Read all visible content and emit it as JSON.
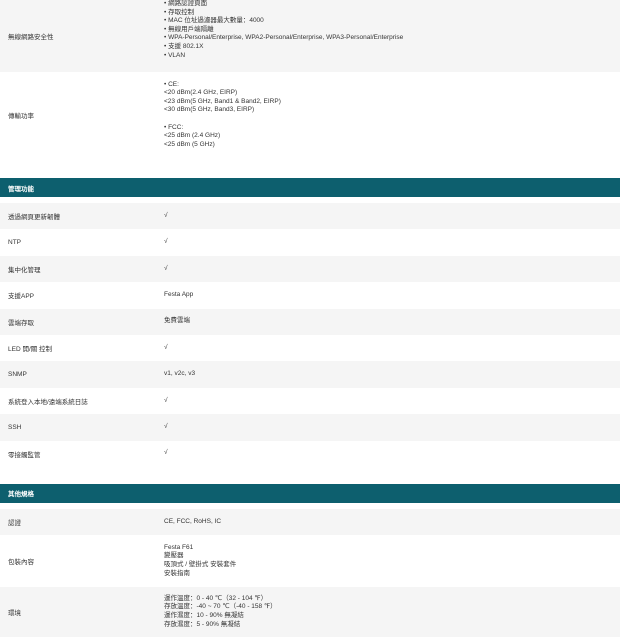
{
  "rows_top": [
    {
      "label": "無線網路安全性",
      "lines": [
        "• 網路認證頁面",
        "• 存取控制",
        "• MAC 位址過濾器最大數量：4000",
        "• 無線用戶端隔離",
        "• WPA-Personal/Enterprise, WPA2-Personal/Enterprise, WPA3-Personal/Enterprise",
        "• 支援 802.1X",
        "• VLAN"
      ]
    },
    {
      "label": "傳輸功率",
      "lines": [
        "• CE:",
        "<20 dBm(2.4 GHz, EIRP)",
        "<23 dBm(5 GHz, Band1 & Band2, EIRP)",
        "<30 dBm(5 GHz, Band3, EIRP)",
        "",
        "• FCC:",
        "<25 dBm (2.4 GHz)",
        "<25 dBm (5 GHz)"
      ]
    }
  ],
  "section_management": {
    "title": "管理功能",
    "rows": [
      {
        "label": "透過網頁更新韌體",
        "value": "√"
      },
      {
        "label": "NTP",
        "value": "√"
      },
      {
        "label": "集中化管理",
        "value": "√"
      },
      {
        "label": "支援APP",
        "value": "Festa App"
      },
      {
        "label": "雲端存取",
        "value": "免費雲端"
      },
      {
        "label": "LED 開/關 控制",
        "value": "√"
      },
      {
        "label": "SNMP",
        "value": "v1, v2c, v3"
      },
      {
        "label": "系統登入本地/遠端系統日誌",
        "value": "√"
      },
      {
        "label": "SSH",
        "value": "√"
      },
      {
        "label": "零接觸監管",
        "value": "√"
      }
    ]
  },
  "section_other": {
    "title": "其他規格",
    "rows": [
      {
        "label": "認證",
        "lines": [
          "CE, FCC, RoHS, IC"
        ]
      },
      {
        "label": "包裝內容",
        "lines": [
          "Festa F61",
          "變壓器",
          "吸頂式 / 壁掛式 安裝套件",
          "安裝指南"
        ]
      },
      {
        "label": "環境",
        "lines": [
          "運作溫度：0 - 40 ℃（32 - 104 ℉）",
          "存放溫度：-40 ~ 70 ℃（-40 - 158 ℉）",
          "運作濕度：10 - 90% 無凝結",
          "存放濕度：5 - 90% 無凝結"
        ]
      }
    ]
  }
}
